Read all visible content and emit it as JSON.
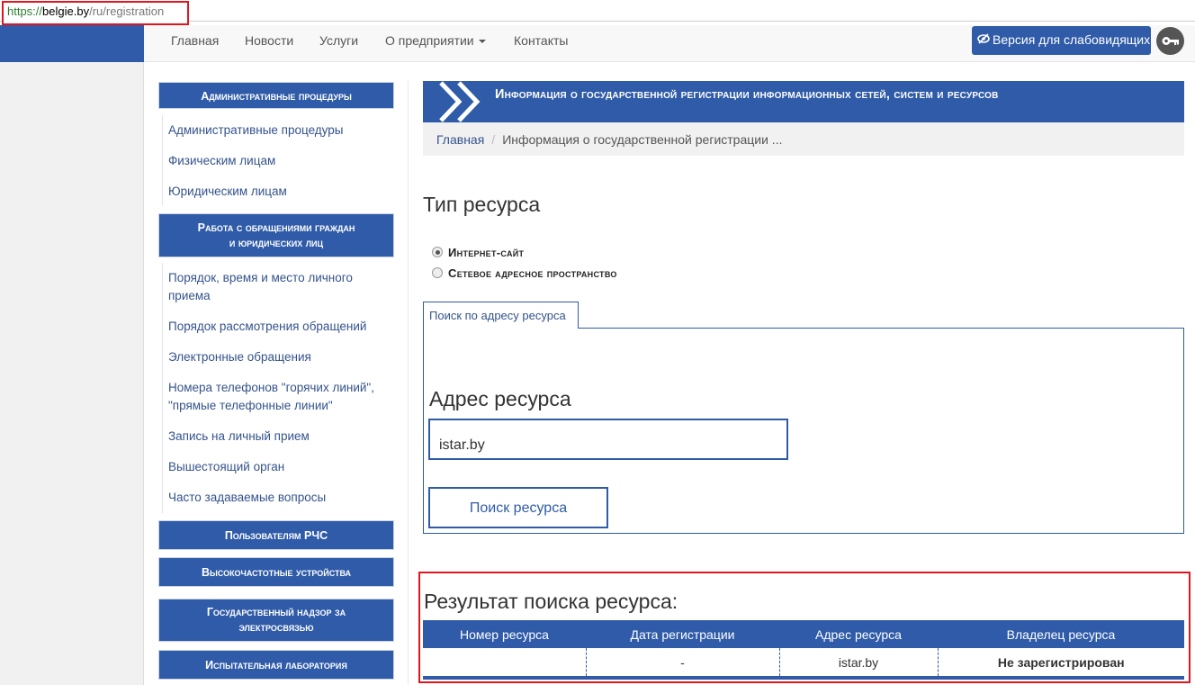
{
  "browser": {
    "url_scheme": "https://",
    "url_host": "belgie.by",
    "url_path": "/ru/registration"
  },
  "nav": {
    "items": [
      "Главная",
      "Новости",
      "Услуги",
      "О предприятии",
      "Контакты"
    ],
    "a11y_label": "Версия для слабовидящих"
  },
  "sidebar": {
    "section1": {
      "title": "Административные процедуры",
      "links": [
        "Административные процедуры",
        "Физическим лицам",
        "Юридическим лицам"
      ]
    },
    "section2": {
      "title_line1": "Работа с обращениями граждан",
      "title_line2": "и юридических лиц",
      "links": [
        "Порядок, время и место личного",
        "приема",
        "Порядок рассмотрения обращений",
        "Электронные обращения",
        "Номера телефонов \"горячих линий\",",
        "\"прямые телефонные линии\"",
        "Запись на личный прием",
        "Вышестоящий орган",
        "Часто задаваемые вопросы"
      ]
    },
    "buttons": [
      "Пользователям РЧС",
      "Высокочастотные устройства",
      "Государственный надзор за",
      "электросвязью",
      "Испытательная лаборатория"
    ]
  },
  "main": {
    "banner_title": "Информация о государственной регистрации информационных сетей, систем и ресурсов",
    "breadcrumb_home": "Главная",
    "breadcrumb_sep": "/",
    "breadcrumb_current": "Информация о государственной регистрации ...",
    "type_heading": "Тип ресурса",
    "radio_options": [
      "Интернет-сайт",
      "Сетевое адресное пространство"
    ],
    "radio_selected": "Интернет-сайт",
    "tab_label": "Поиск по адресу ресурса",
    "address_heading": "Адрес ресурса",
    "address_value": "istar.by",
    "search_button": "Поиск ресурса",
    "result_heading": "Результат поиска ресурса:",
    "result_columns": [
      "Номер ресурса",
      "Дата регистрации",
      "Адрес ресурса",
      "Владелец ресурса"
    ],
    "result_row": [
      "",
      "-",
      "istar.by",
      "Не зарегистрирован"
    ]
  },
  "colors": {
    "brand_blue": "#2f5ba8",
    "alert_red": "#e0171e"
  }
}
